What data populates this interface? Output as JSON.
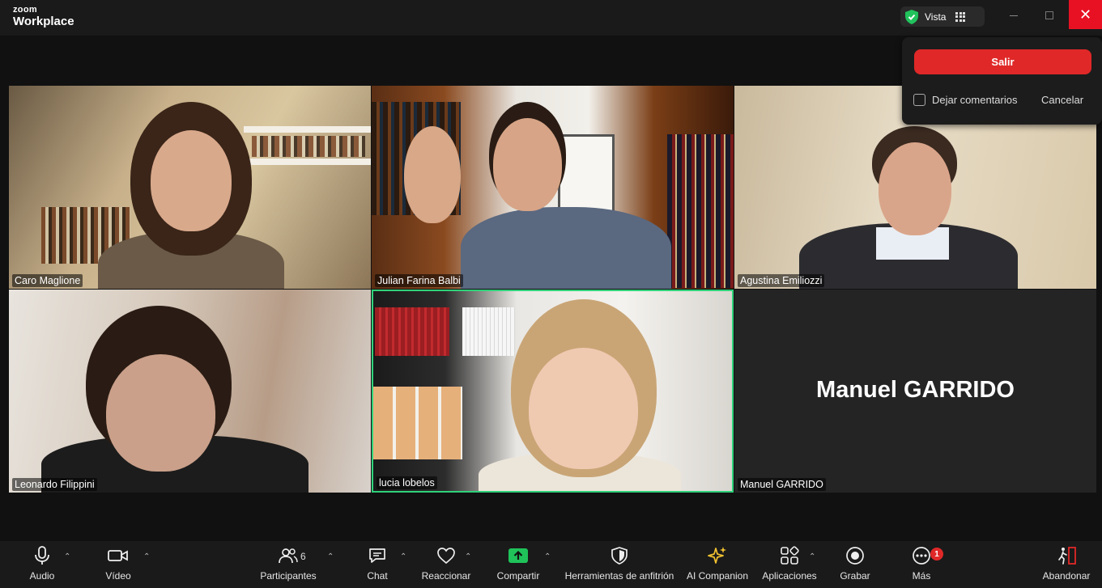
{
  "app": {
    "brand_top": "zoom",
    "brand_bottom": "Workplace"
  },
  "titlebar": {
    "view_label": "Vista",
    "security_icon": "shield-check-icon",
    "grid_icon": "grid-icon"
  },
  "leave_panel": {
    "leave_label": "Salir",
    "feedback_label": "Dejar comentarios",
    "cancel_label": "Cancelar"
  },
  "participants": [
    {
      "name": "Caro Maglione"
    },
    {
      "name": "Julian Farina Balbi"
    },
    {
      "name": "Agustina Emiliozzi"
    },
    {
      "name": "Leonardo Filippini"
    },
    {
      "name": "lucia lobelos"
    },
    {
      "name": "Manuel GARRIDO",
      "display": "Manuel GARRIDO"
    }
  ],
  "toolbar": {
    "audio": "Audio",
    "video": "Vídeo",
    "participants": "Participantes",
    "participants_count": "6",
    "chat": "Chat",
    "react": "Reaccionar",
    "share": "Compartir",
    "host_tools": "Herramientas de anfitrión",
    "ai_companion": "AI Companion",
    "apps": "Aplicaciones",
    "record": "Grabar",
    "more": "Más",
    "more_badge": "1",
    "leave": "Abandonar"
  },
  "colors": {
    "accent_green": "#2fd27a",
    "leave_red": "#e02828",
    "share_green": "#1fc35a",
    "ai_star": "#f2c230"
  }
}
